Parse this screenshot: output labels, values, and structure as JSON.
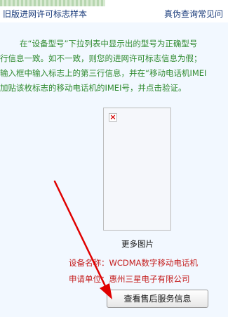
{
  "header": {
    "old_sample_link": "旧版进网许可标志样本",
    "faq_link": "真伪查询常见问"
  },
  "instructions": {
    "lines": [
      "在“设备型号”下拉列表中显示出的型号为正确型号",
      "行信息一致。如不一致，则您的进网许可标志信息为假；",
      "输入框中输入标志上的第三行信息，并在“移动电话机IMEI",
      "加贴该枚标志的移动电话机的IMEI号，并点击验证。"
    ]
  },
  "image_panel": {
    "more_label": "更多图片"
  },
  "device_info": {
    "name_label": "设备名称：",
    "name_value": "WCDMA数字移动电话机",
    "applicant_label": "申请单位：",
    "applicant_value": "惠州三星电子有限公司"
  },
  "actions": {
    "after_sales_button": "查看售后服务信息"
  },
  "colors": {
    "instruction_text": "#2e8a2e",
    "info_text": "#c41c1c",
    "link_text": "#17397a",
    "arrow": "#e00000",
    "panel_bg": "#f2f8ff"
  }
}
